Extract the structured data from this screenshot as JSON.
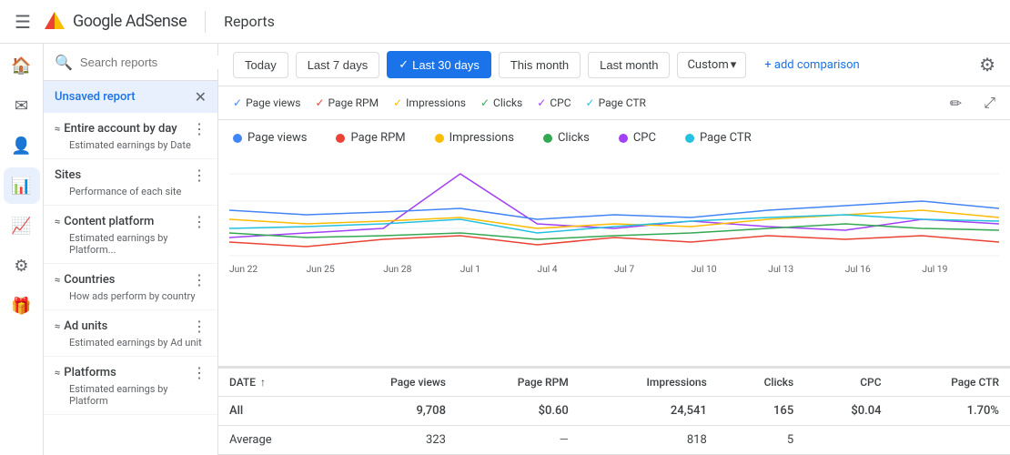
{
  "header": {
    "menu_icon": "☰",
    "logo_text": "Google AdSense",
    "divider": true,
    "title": "Reports"
  },
  "toolbar": {
    "date_buttons": [
      {
        "label": "Today",
        "active": false
      },
      {
        "label": "Last 7 days",
        "active": false
      },
      {
        "label": "Last 30 days",
        "active": true
      },
      {
        "label": "This month",
        "active": false
      },
      {
        "label": "Last month",
        "active": false
      }
    ],
    "custom_label": "Custom",
    "add_comparison_label": "+ add comparison",
    "settings_icon": "⚙"
  },
  "sidebar": {
    "search_placeholder": "Search reports",
    "add_icon": "+",
    "unsaved_report_label": "Unsaved report",
    "items": [
      {
        "id": "entire-account",
        "icon": "≈",
        "title": "Entire account by day",
        "desc": "Estimated earnings by Date"
      },
      {
        "id": "sites",
        "icon": "",
        "title": "Sites",
        "desc": "Performance of each site"
      },
      {
        "id": "content-platform",
        "icon": "≈",
        "title": "Content platform",
        "desc": "Estimated earnings by Platform..."
      },
      {
        "id": "countries",
        "icon": "≈",
        "title": "Countries",
        "desc": "How ads perform by country"
      },
      {
        "id": "ad-units",
        "icon": "≈",
        "title": "Ad units",
        "desc": "Estimated earnings by Ad unit"
      },
      {
        "id": "platforms",
        "icon": "≈",
        "title": "Platforms",
        "desc": "Estimated earnings by Platform"
      }
    ],
    "rail_icons": [
      "🏠",
      "📧",
      "👤",
      "📊",
      "📈",
      "⚙",
      "🎁"
    ]
  },
  "chart": {
    "filter_chips": [
      {
        "label": "Page views",
        "checked": true,
        "color": "#4285f4"
      },
      {
        "label": "Page RPM",
        "checked": true,
        "color": "#ea4335"
      },
      {
        "label": "Impressions",
        "checked": true,
        "color": "#fbbc04"
      },
      {
        "label": "Clicks",
        "checked": true,
        "color": "#34a853"
      },
      {
        "label": "CPC",
        "checked": true,
        "color": "#a142f4"
      },
      {
        "label": "Page CTR",
        "checked": true,
        "color": "#24c1e0"
      }
    ],
    "legend": [
      {
        "label": "Page views",
        "color": "#4285f4"
      },
      {
        "label": "Page RPM",
        "color": "#ea4335"
      },
      {
        "label": "Impressions",
        "color": "#fbbc04"
      },
      {
        "label": "Clicks",
        "color": "#34a853"
      },
      {
        "label": "CPC",
        "color": "#a142f4"
      },
      {
        "label": "Page CTR",
        "color": "#24c1e0"
      }
    ],
    "x_labels": [
      "Jun 22",
      "Jun 25",
      "Jun 28",
      "Jul 1",
      "Jul 4",
      "Jul 7",
      "Jul 10",
      "Jul 13",
      "Jul 16",
      "Jul 19"
    ]
  },
  "table": {
    "columns": [
      "DATE",
      "Page views",
      "Page RPM",
      "Impressions",
      "Clicks",
      "CPC",
      "Page CTR"
    ],
    "rows": [
      {
        "date": "All",
        "page_views": "9,708",
        "page_rpm": "$0.60",
        "impressions": "24,541",
        "clicks": "165",
        "cpc": "$0.04",
        "page_ctr": "1.70%",
        "bold": true
      },
      {
        "date": "Average",
        "page_views": "323",
        "page_rpm": "—",
        "impressions": "818",
        "clicks": "5",
        "cpc": "",
        "page_ctr": "",
        "bold": false
      }
    ]
  }
}
